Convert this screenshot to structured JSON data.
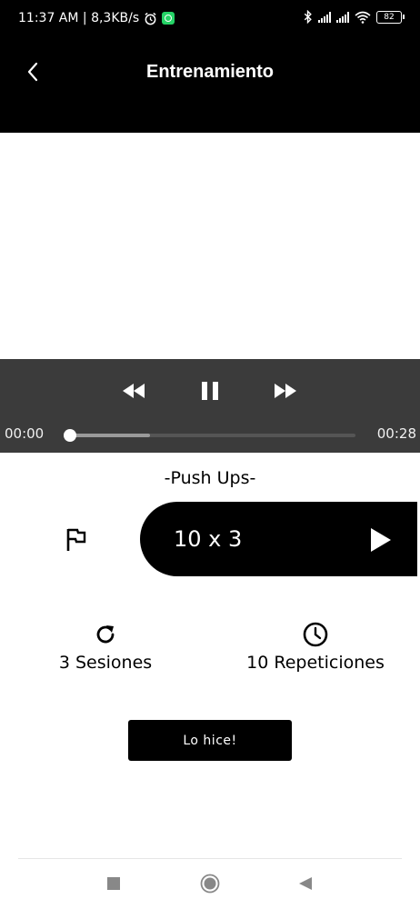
{
  "status_bar": {
    "time_speed": "11:37 AM | 8,3KB/s",
    "alarm_icon": "alarm-clock-icon",
    "whatsapp_icon": "whatsapp-icon",
    "bluetooth_icon": "bluetooth-icon",
    "wifi_icon": "wifi-icon",
    "battery": "82"
  },
  "app_bar": {
    "back_icon": "chevron-left-icon",
    "title": "Entrenamiento"
  },
  "player": {
    "rewind_icon": "rewind-icon",
    "pause_icon": "pause-icon",
    "forward_icon": "fast-forward-icon",
    "current_time": "00:00",
    "total_time": "00:28",
    "progress_fraction": 0.0,
    "buffered_fraction": 0.28
  },
  "exercise": {
    "name": "-Push Ups-",
    "flag_icon": "flag-icon",
    "reps": "10 x 3",
    "play_icon": "play-icon"
  },
  "stats": {
    "sessions_icon": "refresh-icon",
    "sessions_label": "3 Sesiones",
    "reps_icon": "clock-icon",
    "reps_label": "10 Repeticiones"
  },
  "actions": {
    "done_label": "Lo hice!"
  },
  "nav_bar": {
    "recents_icon": "square-icon",
    "home_icon": "circle-icon",
    "back_icon": "triangle-back-icon"
  },
  "colors": {
    "primary": "#000000",
    "player_bg": "#3b3b3b",
    "whatsapp": "#25d366"
  }
}
